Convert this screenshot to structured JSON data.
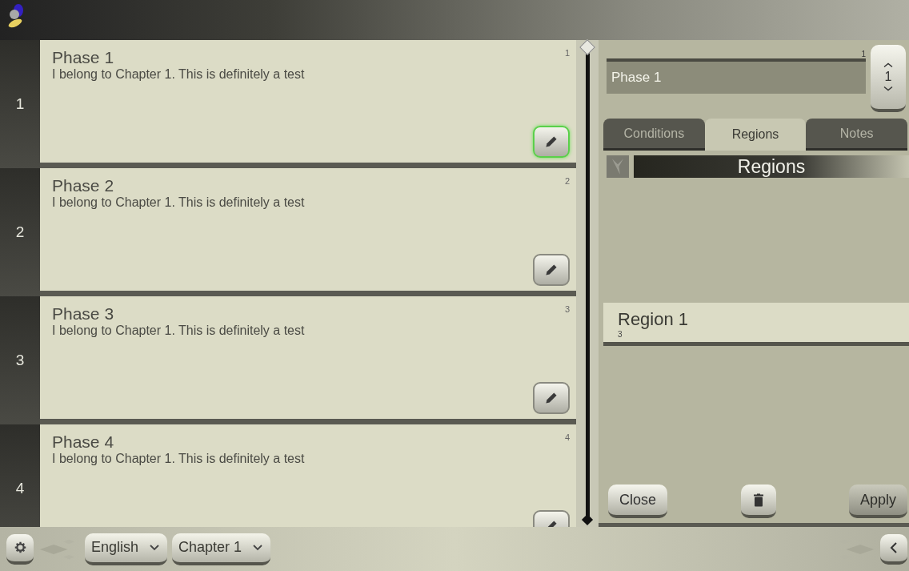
{
  "phases": [
    {
      "row_number": "1",
      "title": "Phase 1",
      "description": "I belong to Chapter 1. This is definitely a test",
      "index": "1",
      "selected": true
    },
    {
      "row_number": "2",
      "title": "Phase 2",
      "description": "I belong to Chapter 1. This is definitely a test",
      "index": "2",
      "selected": false
    },
    {
      "row_number": "3",
      "title": "Phase 3",
      "description": "I belong to Chapter 1. This is definitely a test",
      "index": "3",
      "selected": false
    },
    {
      "row_number": "4",
      "title": "Phase 4",
      "description": "I belong to Chapter 1. This is definitely a test",
      "index": "4",
      "selected": false
    }
  ],
  "editor": {
    "order_label": "1",
    "name_value": "Phase 1",
    "order_value": "1",
    "tabs": [
      {
        "label": "Conditions",
        "selected": false
      },
      {
        "label": "Regions",
        "selected": true
      },
      {
        "label": "Notes",
        "selected": false
      }
    ],
    "section_title": "Regions",
    "regions": [
      {
        "name": "Region 1",
        "count": "3"
      }
    ],
    "buttons": {
      "close": "Close",
      "apply": "Apply"
    }
  },
  "bottom_bar": {
    "language": "English",
    "chapter": "Chapter 1"
  }
}
